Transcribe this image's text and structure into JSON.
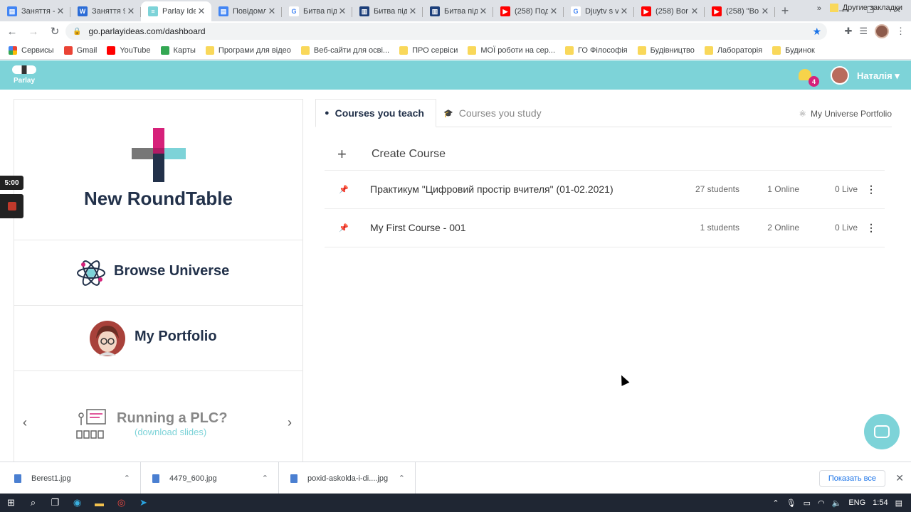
{
  "browser": {
    "tabs": [
      {
        "title": "Заняття -",
        "fav_color": "#4285f4",
        "fav_glyph": "▤"
      },
      {
        "title": "Заняття 9",
        "fav_color": "#2b6cd6",
        "fav_glyph": "W"
      },
      {
        "title": "Parlay Ide",
        "fav_color": "#7dd3d8",
        "fav_glyph": "≡",
        "active": true
      },
      {
        "title": "Повідомл",
        "fav_color": "#4285f4",
        "fav_glyph": "▤"
      },
      {
        "title": "Битва під",
        "fav_color": "#ffffff",
        "fav_glyph": "G"
      },
      {
        "title": "Битва під",
        "fav_color": "#1c3f7a",
        "fav_glyph": "▥"
      },
      {
        "title": "Битва під",
        "fav_color": "#1c3f7a",
        "fav_glyph": "▥"
      },
      {
        "title": "(258) Под",
        "fav_color": "#ff0000",
        "fav_glyph": "▶"
      },
      {
        "title": "Djuytv s v",
        "fav_color": "#ffffff",
        "fav_glyph": "G"
      },
      {
        "title": "(258) Bor",
        "fav_color": "#ff0000",
        "fav_glyph": "▶"
      },
      {
        "title": "(258) \"Bo",
        "fav_color": "#ff0000",
        "fav_glyph": "▶"
      }
    ],
    "url": "go.parlayideas.com/dashboard",
    "bookmarks": [
      {
        "label": "Сервисы",
        "kind": "apps"
      },
      {
        "label": "Gmail",
        "kind": "gmail"
      },
      {
        "label": "YouTube",
        "kind": "youtube"
      },
      {
        "label": "Карты",
        "kind": "maps"
      },
      {
        "label": "Програми для відео",
        "kind": "folder"
      },
      {
        "label": "Веб-сайти для осві...",
        "kind": "folder"
      },
      {
        "label": "ПРО сервіси",
        "kind": "folder"
      },
      {
        "label": "МОЇ роботи на сер...",
        "kind": "folder"
      },
      {
        "label": "ГО Філософія",
        "kind": "folder"
      },
      {
        "label": "Будівництво",
        "kind": "folder"
      },
      {
        "label": "Лабораторія",
        "kind": "folder"
      },
      {
        "label": "Будинок",
        "kind": "folder"
      }
    ],
    "bookmarks_more": "»",
    "other_bookmarks": "Другие закладки"
  },
  "app": {
    "logo_text": "Parlay",
    "notifications_count": "4",
    "user_name": "Наталія ▾",
    "accent_color": "#7dd3d8"
  },
  "left": {
    "timer": "5:00",
    "new_roundtable": "New RoundTable",
    "browse_universe": "Browse Universe",
    "my_portfolio": "My Portfolio",
    "plc_title": "Running a PLC?",
    "plc_link": "(download slides)"
  },
  "main": {
    "tab_teach": "Courses you teach",
    "tab_study": "Courses you study",
    "portfolio_link": "My Universe Portfolio",
    "create_course": "Create Course",
    "courses": [
      {
        "name": "Практикум \"Цифровий простір вчителя\" (01-02.2021)",
        "students": "27 students",
        "online": "1 Online",
        "live": "0 Live"
      },
      {
        "name": "My First Course - 001",
        "students": "1 students",
        "online": "2 Online",
        "live": "0 Live"
      }
    ]
  },
  "downloads": {
    "items": [
      "Berest1.jpg",
      "4479_600.jpg",
      "poxid-askolda-i-di....jpg"
    ],
    "show_all": "Показать все"
  },
  "taskbar": {
    "lang": "ENG",
    "time": "1:54"
  }
}
